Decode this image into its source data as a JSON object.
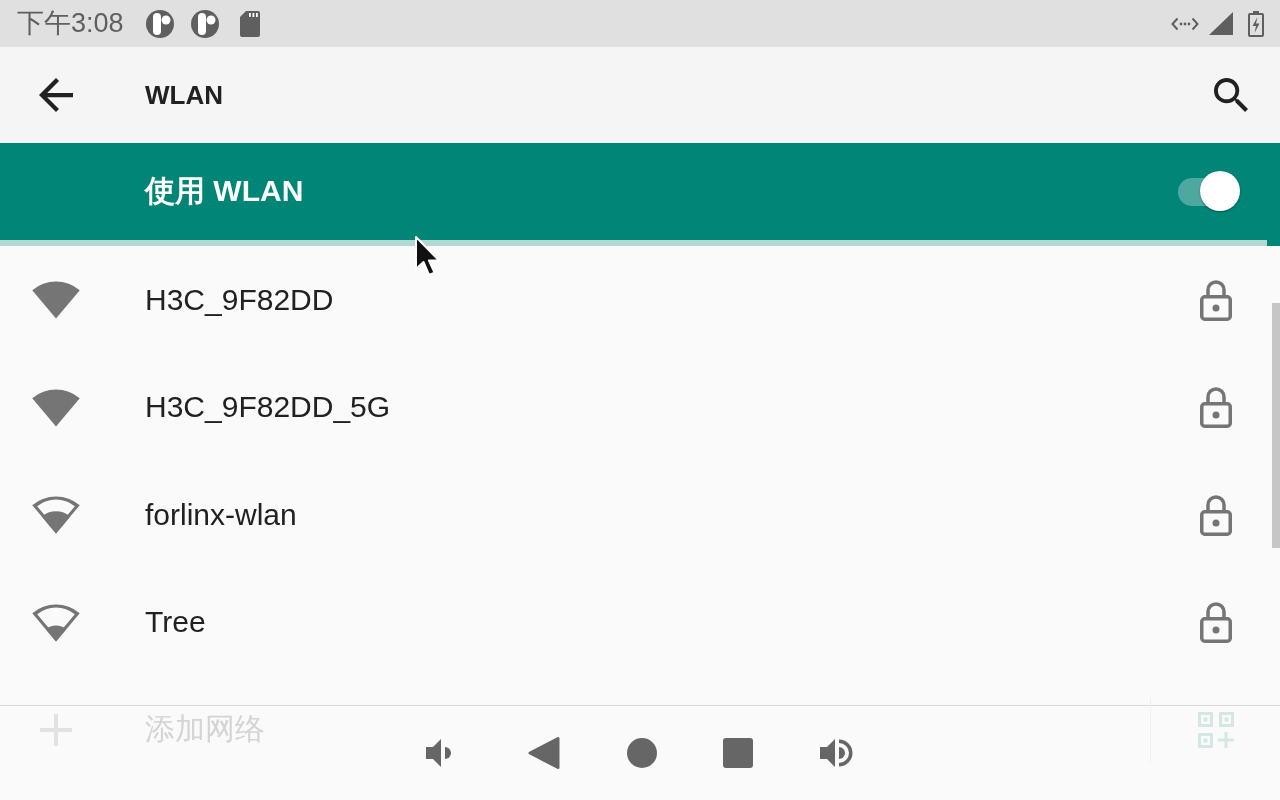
{
  "status_bar": {
    "time": "下午3:08"
  },
  "app_bar": {
    "title": "WLAN"
  },
  "wlan_switch": {
    "label": "使用 WLAN",
    "on": true
  },
  "scan_progress": {
    "level": 0.99
  },
  "networks": [
    {
      "ssid": "H3C_9F82DD",
      "kind": "full",
      "secured": true
    },
    {
      "ssid": "H3C_9F82DD_5G",
      "kind": "full",
      "secured": true
    },
    {
      "ssid": "forlinx-wlan",
      "kind": "medium",
      "secured": true
    },
    {
      "ssid": "Tree",
      "kind": "low",
      "secured": true
    }
  ],
  "add_network": {
    "label": "添加网络"
  }
}
